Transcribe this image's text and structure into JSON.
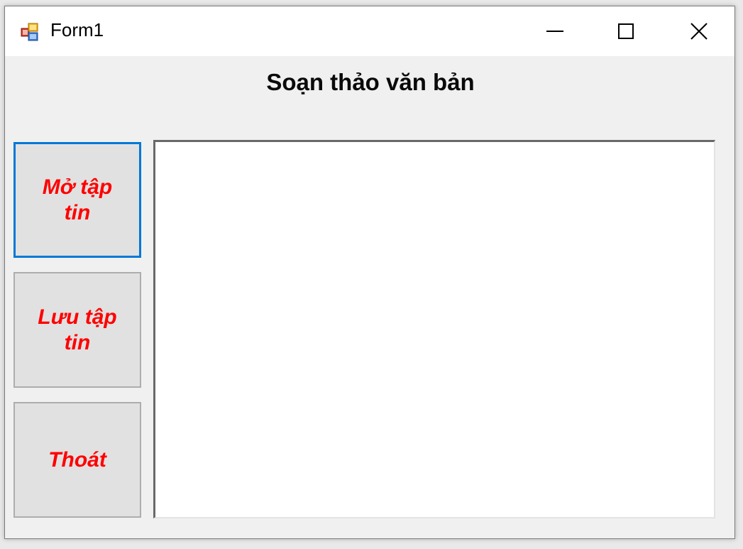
{
  "window": {
    "title": "Form1",
    "icon": "winforms-app-icon",
    "controls": {
      "minimize": "minimize-icon",
      "maximize": "maximize-icon",
      "close": "close-icon"
    }
  },
  "form": {
    "heading": "Soạn thảo văn bản",
    "buttons": {
      "open": "Mở tập tin",
      "save": "Lưu tập tin",
      "exit": "Thoát"
    },
    "button_text_color": "#ff0000",
    "focus_color": "#0078d7",
    "editor": {
      "value": ""
    }
  }
}
